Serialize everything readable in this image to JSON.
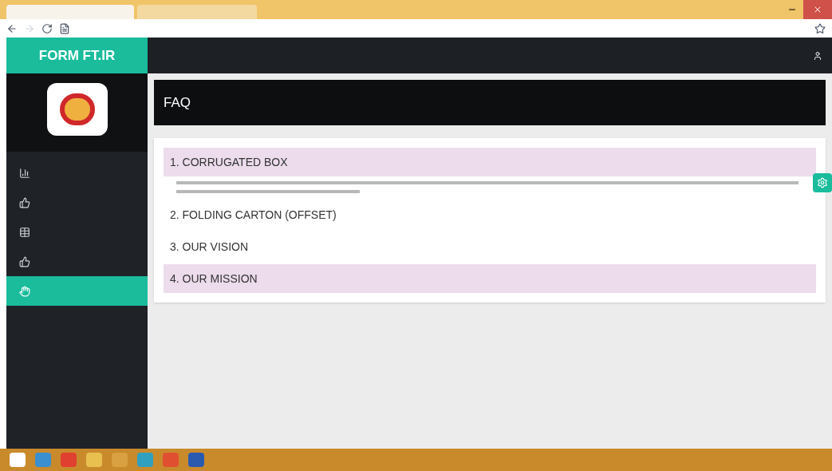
{
  "brand": "FORM FT.IR",
  "sidebar": {
    "items": [
      {
        "kind": "chart",
        "selected": false
      },
      {
        "kind": "thumb",
        "selected": false
      },
      {
        "kind": "table",
        "selected": false
      },
      {
        "kind": "thumb",
        "selected": false
      },
      {
        "kind": "hand",
        "selected": true
      }
    ]
  },
  "page_title": "FAQ",
  "faq": [
    {
      "title": "1. CORRUGATED BOX",
      "expanded": true,
      "highlighted": true
    },
    {
      "title": "2. FOLDING CARTON (OFFSET)",
      "expanded": false,
      "highlighted": false
    },
    {
      "title": "3. OUR VISION",
      "expanded": false,
      "highlighted": false
    },
    {
      "title": "4. OUR MISSION",
      "expanded": false,
      "highlighted": true
    }
  ]
}
